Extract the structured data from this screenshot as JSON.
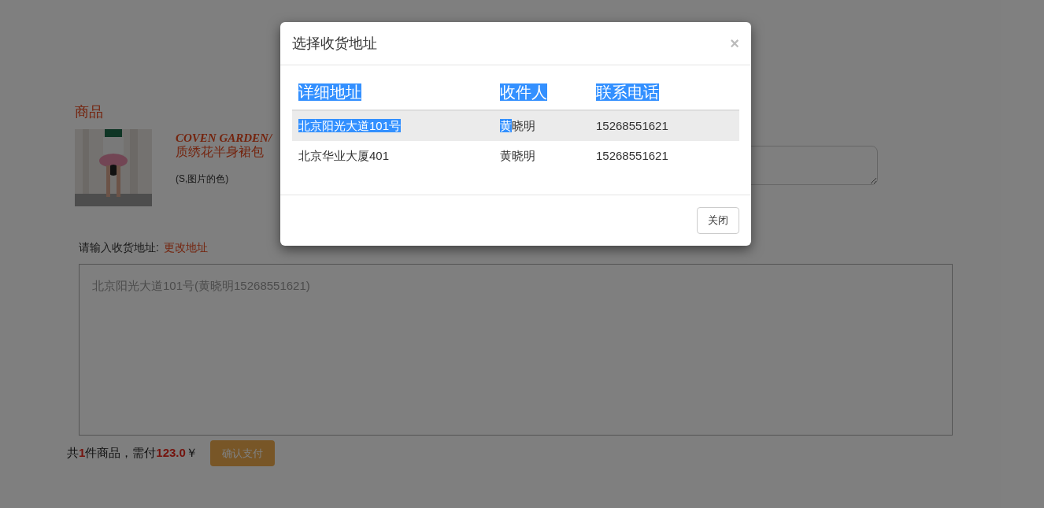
{
  "page": {
    "goods_heading": "商品",
    "product": {
      "name_latin": "COVEN GARDEN/",
      "name_cn": "质绣花半身裙包",
      "variant": "(S,图片的色)"
    },
    "address_label": "请输入收货地址:",
    "change_address_link": "更改地址",
    "address_field": {
      "placeholder": "北京阳光大道101号(黄晓明15268551621)"
    },
    "summary": {
      "prefix": "共",
      "count": "1",
      "middle": "件商品，需付",
      "amount": "123.0",
      "suffix": "￥"
    },
    "pay_button": "确认支付"
  },
  "modal": {
    "title": "选择收货地址",
    "close_icon": "×",
    "columns": [
      {
        "label": "详细地址",
        "highlighted": true
      },
      {
        "label": "收件人",
        "highlighted": true
      },
      {
        "label": "联系电话",
        "highlighted": true
      }
    ],
    "rows": [
      {
        "hovered": true,
        "cells": [
          [
            {
              "text": "北京阳光大道101号",
              "highlighted": true
            }
          ],
          [
            {
              "text": "黄",
              "highlighted": true
            },
            {
              "text": "晓明",
              "highlighted": false
            }
          ],
          [
            {
              "text": "15268551621",
              "highlighted": false
            }
          ]
        ]
      },
      {
        "hovered": false,
        "cells": [
          [
            {
              "text": "北京华业大厦401",
              "highlighted": false
            }
          ],
          [
            {
              "text": "黄晓明",
              "highlighted": false
            }
          ],
          [
            {
              "text": "15268551621",
              "highlighted": false
            }
          ]
        ]
      }
    ],
    "close_button": "关闭"
  }
}
